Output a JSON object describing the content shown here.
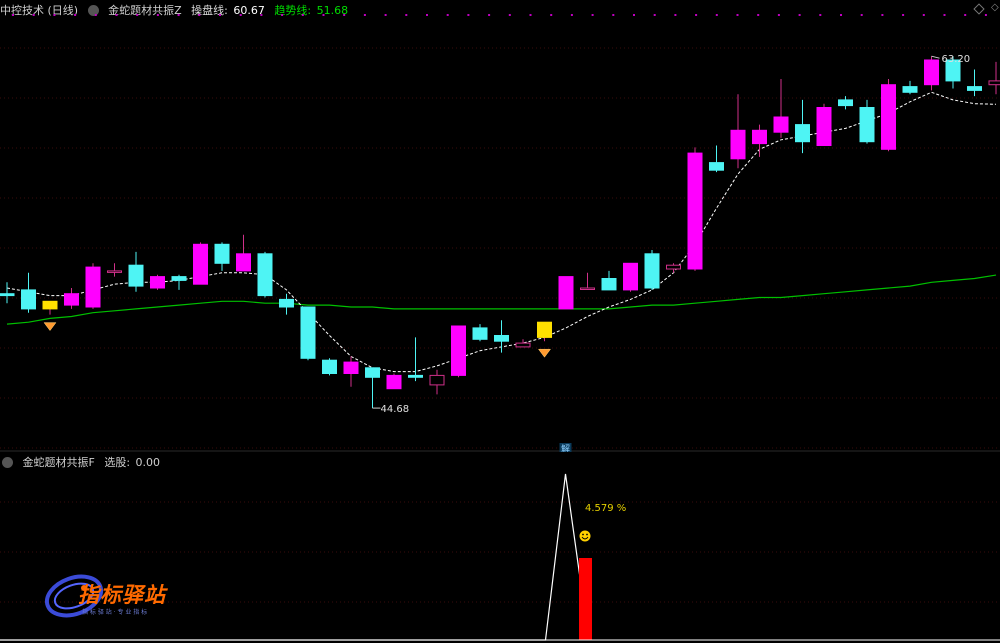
{
  "main_header": {
    "stock": "中控技术 (日线)",
    "indicator": "金蛇题材共振Z",
    "op_label": "操盘线:",
    "op_value": "60.67",
    "trend_label": "趋势线:",
    "trend_value": "51.68",
    "colors": {
      "op": "#ffffff",
      "trend": "#00dc00"
    }
  },
  "sub_header": {
    "indicator": "金蛇题材共振F",
    "select_label": "选股:",
    "select_value": "0.00"
  },
  "annotations": {
    "high_label": "63.20",
    "low_label": "44.68",
    "jie_label": "解",
    "pct_label": "4.579 %",
    "smile": "☻"
  },
  "watermark": {
    "title": "指标驿站",
    "subtitle": "指 标 驿 站 · 专 业 指 标"
  },
  "chart_data": [
    {
      "type": "candlestick",
      "title": "中控技术 (日线)",
      "ylim": [
        43,
        65
      ],
      "colors": {
        "up": "#ff00ff",
        "down": "#4ef4f4",
        "signal": "#ffe000",
        "ma_trend": "#00c000",
        "ma_op": "#ffffff"
      },
      "candles": [
        {
          "o": 50.7,
          "h": 51.3,
          "l": 50.2,
          "c": 50.6
        },
        {
          "o": 50.9,
          "h": 51.8,
          "l": 49.7,
          "c": 49.9
        },
        {
          "o": 49.9,
          "h": 50.3,
          "l": 49.6,
          "c": 50.3,
          "signal": true
        },
        {
          "o": 50.1,
          "h": 51.0,
          "l": 49.9,
          "c": 50.7
        },
        {
          "o": 50.0,
          "h": 52.3,
          "l": 49.9,
          "c": 52.1
        },
        {
          "o": 51.9,
          "h": 52.3,
          "l": 51.6,
          "c": 51.9
        },
        {
          "o": 52.2,
          "h": 52.9,
          "l": 50.8,
          "c": 51.1
        },
        {
          "o": 51.0,
          "h": 51.7,
          "l": 50.9,
          "c": 51.6
        },
        {
          "o": 51.6,
          "h": 51.7,
          "l": 50.9,
          "c": 51.4
        },
        {
          "o": 51.2,
          "h": 53.4,
          "l": 51.2,
          "c": 53.3
        },
        {
          "o": 53.3,
          "h": 53.4,
          "l": 51.9,
          "c": 52.3
        },
        {
          "o": 51.9,
          "h": 53.8,
          "l": 51.9,
          "c": 52.8
        },
        {
          "o": 52.8,
          "h": 52.9,
          "l": 50.5,
          "c": 50.6
        },
        {
          "o": 50.4,
          "h": 50.7,
          "l": 49.6,
          "c": 50.0
        },
        {
          "o": 50.0,
          "h": 50.0,
          "l": 47.2,
          "c": 47.3
        },
        {
          "o": 47.2,
          "h": 47.3,
          "l": 46.4,
          "c": 46.5
        },
        {
          "o": 46.5,
          "h": 47.4,
          "l": 45.8,
          "c": 47.1
        },
        {
          "o": 46.8,
          "h": 46.8,
          "l": 44.68,
          "c": 46.3
        },
        {
          "o": 45.7,
          "h": 46.5,
          "l": 45.7,
          "c": 46.4
        },
        {
          "o": 46.4,
          "h": 48.4,
          "l": 46.1,
          "c": 46.3
        },
        {
          "o": 45.9,
          "h": 46.7,
          "l": 45.4,
          "c": 46.4
        },
        {
          "o": 46.4,
          "h": 49.0,
          "l": 46.3,
          "c": 49.0
        },
        {
          "o": 48.9,
          "h": 49.1,
          "l": 48.2,
          "c": 48.3
        },
        {
          "o": 48.5,
          "h": 49.3,
          "l": 47.6,
          "c": 48.2
        },
        {
          "o": 47.9,
          "h": 48.3,
          "l": 47.9,
          "c": 48.1
        },
        {
          "o": 48.4,
          "h": 49.2,
          "l": 48.2,
          "c": 49.2,
          "signal": true
        },
        {
          "o": 49.9,
          "h": 51.6,
          "l": 49.9,
          "c": 51.6
        },
        {
          "o": 51.0,
          "h": 51.8,
          "l": 50.9,
          "c": 51.0
        },
        {
          "o": 51.5,
          "h": 51.9,
          "l": 50.9,
          "c": 50.9
        },
        {
          "o": 50.9,
          "h": 52.3,
          "l": 50.8,
          "c": 52.3
        },
        {
          "o": 52.8,
          "h": 53.0,
          "l": 50.9,
          "c": 51.0
        },
        {
          "o": 52.0,
          "h": 52.3,
          "l": 51.8,
          "c": 52.2
        },
        {
          "o": 52.0,
          "h": 58.4,
          "l": 51.9,
          "c": 58.1
        },
        {
          "o": 57.6,
          "h": 58.5,
          "l": 57.1,
          "c": 57.2
        },
        {
          "o": 57.8,
          "h": 61.2,
          "l": 57.3,
          "c": 59.3
        },
        {
          "o": 58.6,
          "h": 59.6,
          "l": 57.9,
          "c": 59.3
        },
        {
          "o": 59.2,
          "h": 62.0,
          "l": 58.9,
          "c": 60.0
        },
        {
          "o": 59.6,
          "h": 60.9,
          "l": 58.1,
          "c": 58.7
        },
        {
          "o": 58.5,
          "h": 60.7,
          "l": 58.5,
          "c": 60.5
        },
        {
          "o": 60.9,
          "h": 61.1,
          "l": 60.4,
          "c": 60.6
        },
        {
          "o": 60.5,
          "h": 60.9,
          "l": 58.6,
          "c": 58.7
        },
        {
          "o": 58.3,
          "h": 62.0,
          "l": 58.2,
          "c": 61.7
        },
        {
          "o": 61.6,
          "h": 61.9,
          "l": 61.2,
          "c": 61.3
        },
        {
          "o": 61.7,
          "h": 63.2,
          "l": 61.4,
          "c": 63.0
        },
        {
          "o": 63.0,
          "h": 63.2,
          "l": 61.5,
          "c": 61.9
        },
        {
          "o": 61.6,
          "h": 62.5,
          "l": 61.1,
          "c": 61.4
        },
        {
          "o": 61.7,
          "h": 62.9,
          "l": 61.2,
          "c": 61.9
        }
      ],
      "ma_trend": [
        49.1,
        49.2,
        49.4,
        49.5,
        49.7,
        49.8,
        49.9,
        50.0,
        50.1,
        50.2,
        50.3,
        50.3,
        50.2,
        50.2,
        50.1,
        50.1,
        50.0,
        50.0,
        49.9,
        49.9,
        49.9,
        49.9,
        49.9,
        49.9,
        49.9,
        49.9,
        49.9,
        49.9,
        49.9,
        50.0,
        50.1,
        50.1,
        50.2,
        50.3,
        50.4,
        50.5,
        50.5,
        50.6,
        50.7,
        50.8,
        50.9,
        51.0,
        51.1,
        51.3,
        51.4,
        51.5,
        51.68
      ],
      "ma_op": [
        51.0,
        50.8,
        50.6,
        50.6,
        50.9,
        51.2,
        51.3,
        51.3,
        51.4,
        51.6,
        51.8,
        51.8,
        51.7,
        50.9,
        49.7,
        48.5,
        47.4,
        46.8,
        46.6,
        46.6,
        46.9,
        47.3,
        47.7,
        47.9,
        48.1,
        48.4,
        48.9,
        49.5,
        50.0,
        50.4,
        50.9,
        51.8,
        53.3,
        55.2,
        57.0,
        58.3,
        58.8,
        59.0,
        59.2,
        59.4,
        59.8,
        60.2,
        60.8,
        61.3,
        60.9,
        60.7,
        60.67
      ]
    },
    {
      "type": "line",
      "title": "金蛇题材共振F",
      "series": [
        {
          "name": "选股",
          "values": [
            0,
            0,
            0,
            0,
            0,
            0,
            0,
            0,
            0,
            0,
            0,
            0,
            0,
            0,
            0,
            0,
            0,
            0,
            0,
            0,
            0,
            0,
            0,
            0,
            0,
            0,
            0,
            0,
            0,
            0,
            0,
            0,
            0,
            0,
            0,
            0,
            0,
            0,
            0,
            0,
            0,
            0,
            0,
            0,
            0,
            0,
            0
          ]
        }
      ],
      "spike": {
        "index": 25,
        "value": 1.0
      },
      "bar": {
        "index": 26,
        "value": 4.579
      },
      "ylim": [
        0,
        5.0
      ]
    }
  ]
}
